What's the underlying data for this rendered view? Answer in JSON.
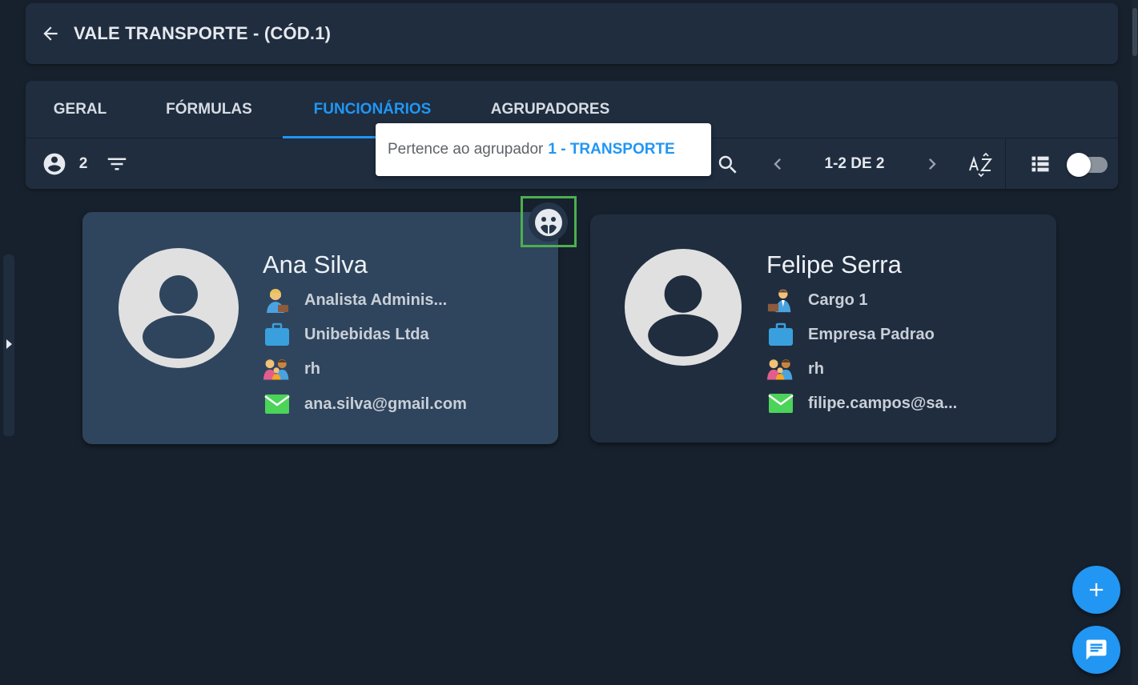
{
  "header": {
    "title": "VALE TRANSPORTE - (CÓD.1)",
    "back_icon": "arrow-left-icon"
  },
  "tabs": [
    {
      "label": "GERAL",
      "active": false
    },
    {
      "label": "FÓRMULAS",
      "active": false
    },
    {
      "label": "FUNCIONÁRIOS",
      "active": true
    },
    {
      "label": "AGRUPADORES",
      "active": false
    }
  ],
  "toolbar": {
    "employee_count": "2",
    "pagination": "1-2 DE 2",
    "view_toggle_on": false
  },
  "tooltip": {
    "prefix": "Pertence ao agrupador",
    "group": "1 - TRANSPORTE"
  },
  "employees": [
    {
      "name": "Ana Silva",
      "role": "Analista Adminis...",
      "company": "Unibebidas Ltda",
      "department": "rh",
      "email": "ana.silva@gmail.com"
    },
    {
      "name": "Felipe Serra",
      "role": "Cargo 1",
      "company": "Empresa Padrao",
      "department": "rh",
      "email": "filipe.campos@sa..."
    }
  ],
  "colors": {
    "accent": "#2196f3",
    "background": "#17212d",
    "surface": "#1f2d3f",
    "highlight_card": "#2f455e",
    "highlight_border": "#4caf50"
  }
}
